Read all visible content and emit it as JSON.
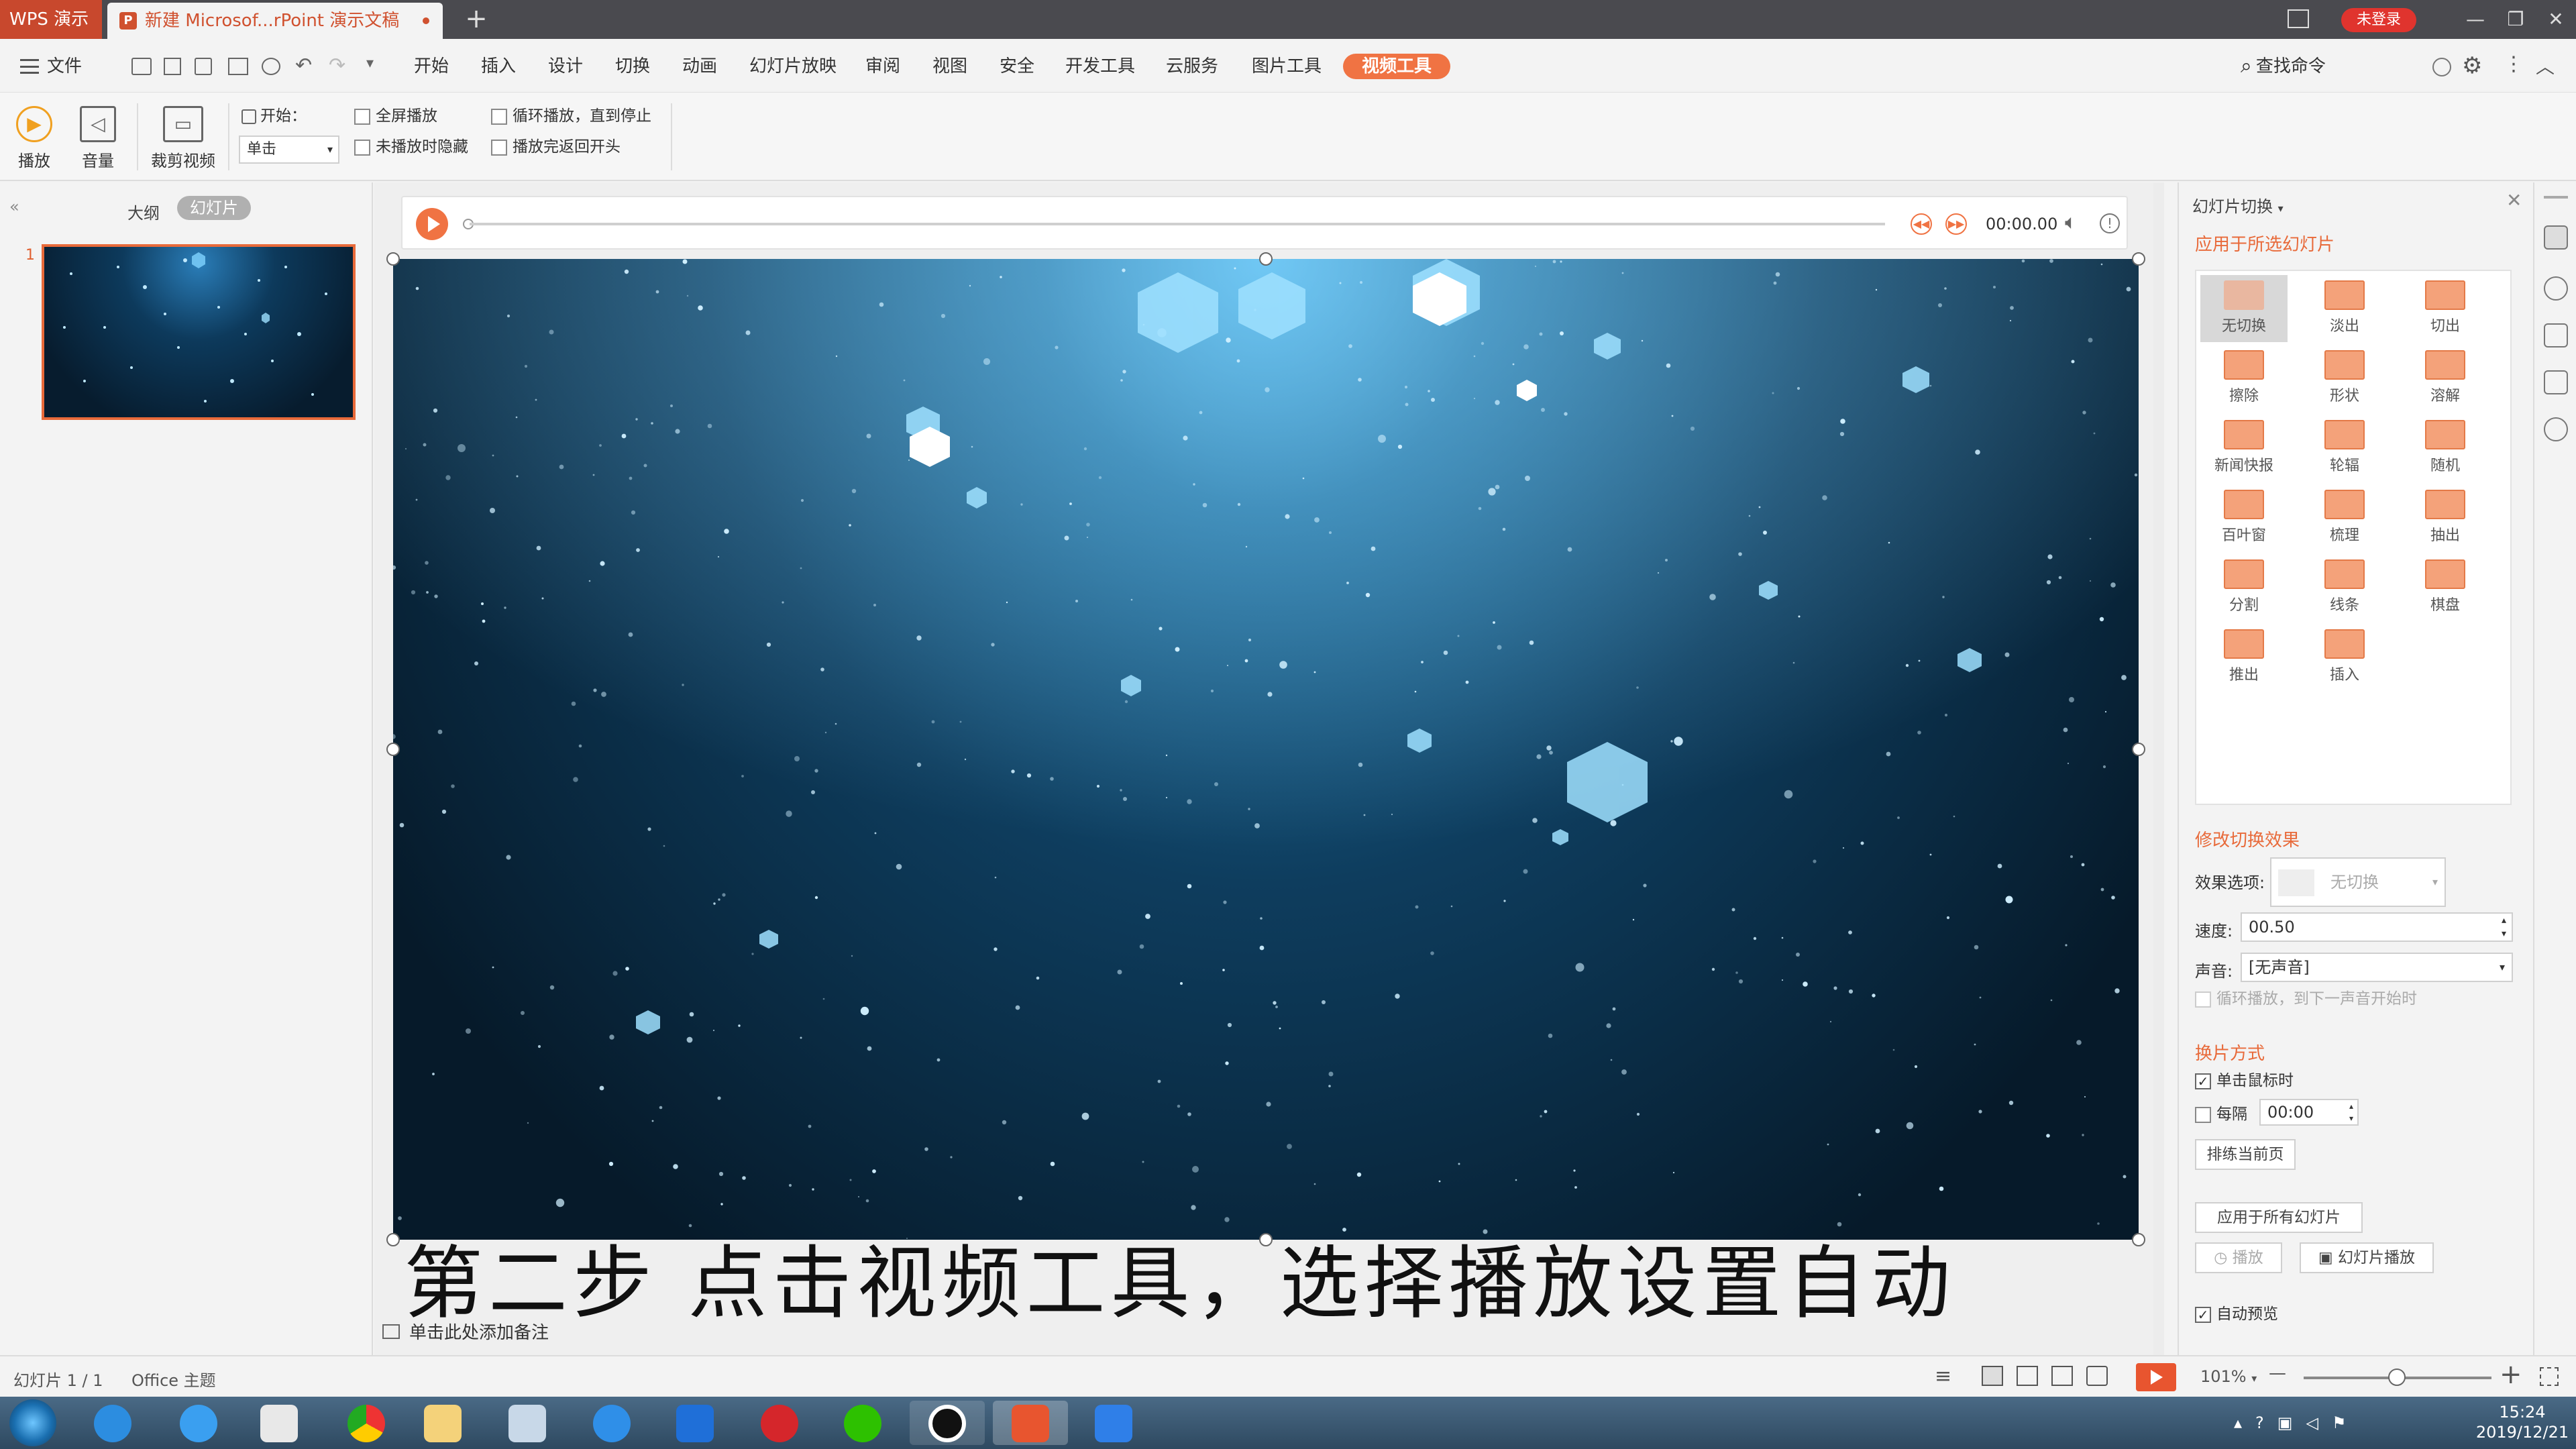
{
  "titlebar": {
    "app_name": "WPS 演示",
    "doc_tab": "新建 Microsof...rPoint 演示文稿",
    "new_tab": "+",
    "login": "未登录",
    "min": "—",
    "restore": "❐",
    "close": "✕"
  },
  "menu": {
    "file": "文件",
    "items": [
      "开始",
      "插入",
      "设计",
      "切换",
      "动画",
      "幻灯片放映",
      "审阅",
      "视图",
      "安全",
      "开发工具",
      "云服务",
      "图片工具",
      "视频工具"
    ],
    "active": "视频工具",
    "search": "查找命令"
  },
  "ribbon": {
    "play": "播放",
    "volume": "音量",
    "trim": "裁剪视频",
    "start_label": "开始：",
    "start_value": "单击",
    "fullscreen": "全屏播放",
    "hide_not_playing": "未播放时隐藏",
    "loop": "循环播放，直到停止",
    "rewind": "播放完返回开头"
  },
  "left_panel": {
    "outline_tab": "大纲",
    "slides_tab": "幻灯片",
    "thumb_number": "1"
  },
  "player": {
    "time": "00:00.00"
  },
  "caption": "第二步 点击视频工具，选择播放设置自动",
  "notes": "单击此处添加备注",
  "right_panel": {
    "title": "幻灯片切换",
    "apply_selected": "应用于所选幻灯片",
    "transitions": [
      "无切换",
      "淡出",
      "切出",
      "擦除",
      "形状",
      "溶解",
      "新闻快报",
      "轮辐",
      "随机",
      "百叶窗",
      "梳理",
      "抽出",
      "分割",
      "线条",
      "棋盘",
      "推出",
      "插入"
    ],
    "selected_transition": "无切换",
    "modify_effect": "修改切换效果",
    "effect_option_label": "效果选项:",
    "effect_option_value": "无切换",
    "speed_label": "速度:",
    "speed_value": "00.50",
    "sound_label": "声音:",
    "sound_value": "[无声音]",
    "loop_until_next_sound": "循环播放，到下一声音开始时",
    "advance_title": "换片方式",
    "on_click": "单击鼠标时",
    "every": "每隔",
    "every_value": "00:00",
    "rehearse": "排练当前页",
    "apply_all": "应用于所有幻灯片",
    "play_btn": "播放",
    "slideshow_btn": "幻灯片播放",
    "auto_preview": "自动预览"
  },
  "status": {
    "slide_info": "幻灯片 1 / 1",
    "theme": "Office 主题",
    "zoom": "101%",
    "zoom_minus": "—",
    "zoom_plus": "+"
  },
  "taskbar": {
    "time": "15:24",
    "date": "2019/12/21"
  },
  "colors": {
    "accent": "#f07343",
    "app_badge": "#c8482d",
    "login": "#e0342e",
    "taskbar": "#2e4960"
  }
}
